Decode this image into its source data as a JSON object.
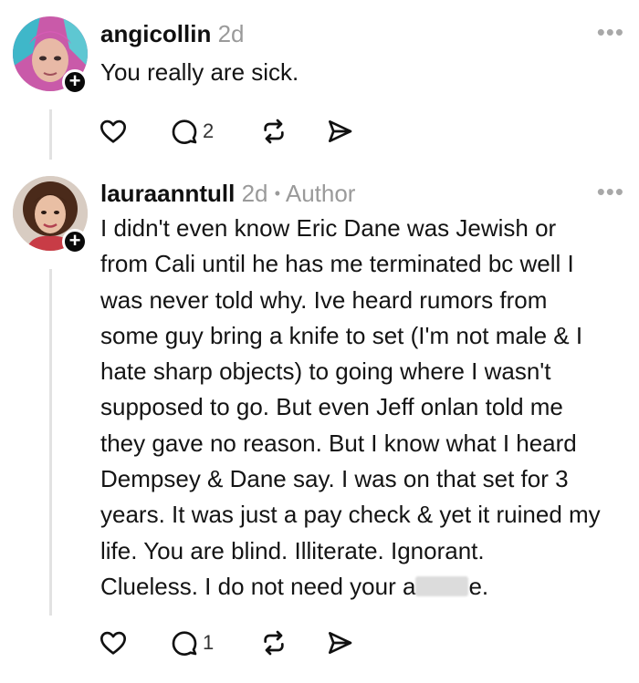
{
  "posts": [
    {
      "username": "angicollin",
      "time": "2d",
      "author_tag": "",
      "text_lines": [
        "You really are sick."
      ],
      "reply_count": "2"
    },
    {
      "username": "lauraanntull",
      "time": "2d",
      "separator": "•",
      "author_tag": "Author",
      "text_lines": [
        "I didn't even know Eric Dane was Jewish or",
        "from Cali until he has me terminated bc well I",
        "was never told why.  Ive heard rumors from",
        "some guy bring a knife to set (I'm not male & I",
        "hate sharp objects) to going where I wasn't",
        "supposed to go.  But even Jeff onlan told me",
        "they gave no reason. But I know what I heard",
        "Dempsey & Dane say.  I was on that set for 3",
        "years. It was just a pay check & yet it ruined my",
        "life.  You are blind.  Illiterate.  Ignorant.",
        "Clueless.  I do not need your a"
      ],
      "last_line_suffix": "e.",
      "reply_count": "1"
    }
  ],
  "icons": {
    "more": "more-icon",
    "like": "heart-icon",
    "reply": "comment-icon",
    "repost": "repost-icon",
    "share": "send-icon",
    "follow": "plus-icon"
  },
  "more_glyph": "•••",
  "follow_glyph": "+",
  "colors": {
    "thread_line": "#e2e2e2",
    "meta_text": "#9a9a9a",
    "blur_box": "#dcdcdc"
  }
}
